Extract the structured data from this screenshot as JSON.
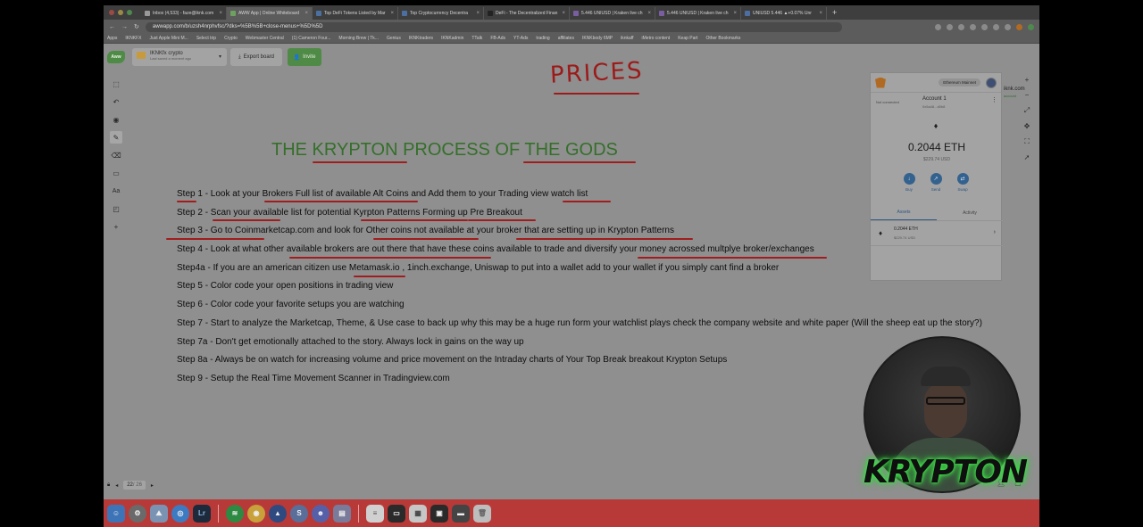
{
  "browser": {
    "tabs": [
      {
        "label": "Inbox (4,533) - faze@iknk.com",
        "active": false
      },
      {
        "label": "AWW App | Online Whiteboard",
        "active": true
      },
      {
        "label": "Top DeFi Tokens Listed by Mar",
        "active": false
      },
      {
        "label": "Top Cryptocurrency Decentra",
        "active": false
      },
      {
        "label": "DeFi - The Decentralized Finan",
        "active": false
      },
      {
        "label": "5.446 UNIUSD | Kraken live ch",
        "active": false
      },
      {
        "label": "5.446 UNIUSD | Kraken live ch",
        "active": false
      },
      {
        "label": "UNIUSD 5.446 ▲+0.07% Unr",
        "active": false
      }
    ],
    "url": "awwapp.com/b/uzsh4nrphvfsc/?dks=%5B%5B+close-menus+%5D%5D",
    "bookmarks": [
      "Apps",
      "IKNKFX",
      "Just Apple Mini M...",
      "Select trip",
      "Crypto",
      "Webmaster Central",
      "(1) Cameron Four...",
      "Morning Brew | Tk...",
      "Genius",
      "IKNKtraders",
      "IKNKadmin",
      "TTalk",
      "FB-Ads",
      "YT-Ads",
      "trading",
      "affiliates",
      "IKNKbody 6MP",
      "iknkaff",
      "iMetro content",
      "Keap Part",
      "Other Bookmarks"
    ]
  },
  "whiteboard": {
    "logo": "Aww",
    "board_name": "IKNKfx crypto",
    "board_sub": "Last saved a moment ago",
    "export_label": "Export board",
    "invite_label": "Invite",
    "pager": {
      "current": "22",
      "total": "/ 26"
    },
    "prices": "PRICES",
    "headline": "THE KRYPTON PROCESS OF THE GODS",
    "steps": [
      "Step 1 - Look at your Brokers Full list of available Alt Coins and Add them to your Trading view watch list",
      "Step 2 - Scan your available list for potential Kyrpton Patterns Forming up Pre Breakout",
      "Step 3 - Go to Coinmarketcap.com and look for Other coins not available at your broker that are setting up in Krypton Patterns",
      "Step 4 - Look at what other available brokers are out there that have these coins available to trade and diversify your money acrossed multplye broker/exchanges",
      "Step4a - If you are an american citizen use Metamask.io , 1inch.exchange, Uniswap to put into a wallet add to your wallet if you simply cant find a broker",
      "Step 5 - Color code your open positions in trading view",
      "Step 6 - Color code your favorite setups you are watching",
      "Step 7 - Start to analyze the Marketcap, Theme, & Use case to back up why this may be a huge run form your watchlist plays check the company website and white paper (Will the sheep eat up the story?)",
      "Step 7a - Don't get emotionally attached to the story. Always lock in gains on the way up",
      "Step 8a - Always be on watch for increasing volume and price movement on the Intraday charts of Your Top Break breakout Krypton Setups",
      "Step 9 - Setup the Real Time Movement Scanner in Tradingview.com"
    ]
  },
  "metamask": {
    "network": "Ethereum Mainnet",
    "not_connected": "Not connected",
    "account_name": "Account 1",
    "account_addr": "0x5a48...d0b8",
    "balance": "0.2044 ETH",
    "balance_usd": "$229.74 USD",
    "actions": [
      "Buy",
      "Send",
      "Swap"
    ],
    "tabs": [
      "Assets",
      "Activity"
    ],
    "asset_amount": "0.2044 ETH",
    "asset_usd": "$229.74 USD",
    "side_text_1": "iknk.com",
    "side_text_2": "account"
  },
  "overlay": {
    "brand": "KRYPTON"
  },
  "dock": {
    "items": [
      "finder",
      "system-preferences",
      "photos",
      "safari",
      "lightroom",
      "spotify",
      "chrome",
      "brave",
      "slack",
      "discord",
      "preview",
      "notes",
      "terminal",
      "calculator",
      "screenshot",
      "trash"
    ]
  },
  "colors": {
    "ink_red": "#a11d1d",
    "headline_green": "#356f2a",
    "krypton_glow": "#3fe04a"
  }
}
